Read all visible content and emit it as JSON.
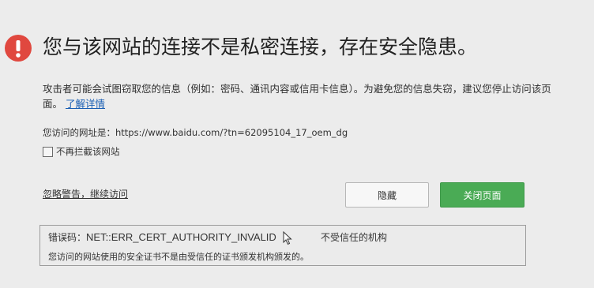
{
  "warning": {
    "icon": "exclamation-icon",
    "icon_color": "#e0483f",
    "headline": "您与该网站的连接不是私密连接，存在安全隐患。",
    "description": "攻击者可能会试图窃取您的信息（例如：密码、通讯内容或信用卡信息）。为避免您的信息失窃，建议您停止访问该页面。",
    "learn_more_link": "了解详情",
    "url_line": "您访问的网址是：https://www.baidu.com/?tn=62095104_17_oem_dg",
    "dont_intercept_checkbox": {
      "label": "不再拦截该网站",
      "checked": false
    },
    "ignore_link": "忽略警告，继续访问",
    "hide_button": "隐藏",
    "close_button": "关闭页面",
    "close_button_color": "#4aab55",
    "error": {
      "code_label": "错误码：",
      "code": "NET::ERR_CERT_AUTHORITY_INVALID",
      "reason": "不受信任的机构",
      "detail": "您访问的网站使用的安全证书不是由受信任的证书颁发机构颁发的。"
    }
  }
}
